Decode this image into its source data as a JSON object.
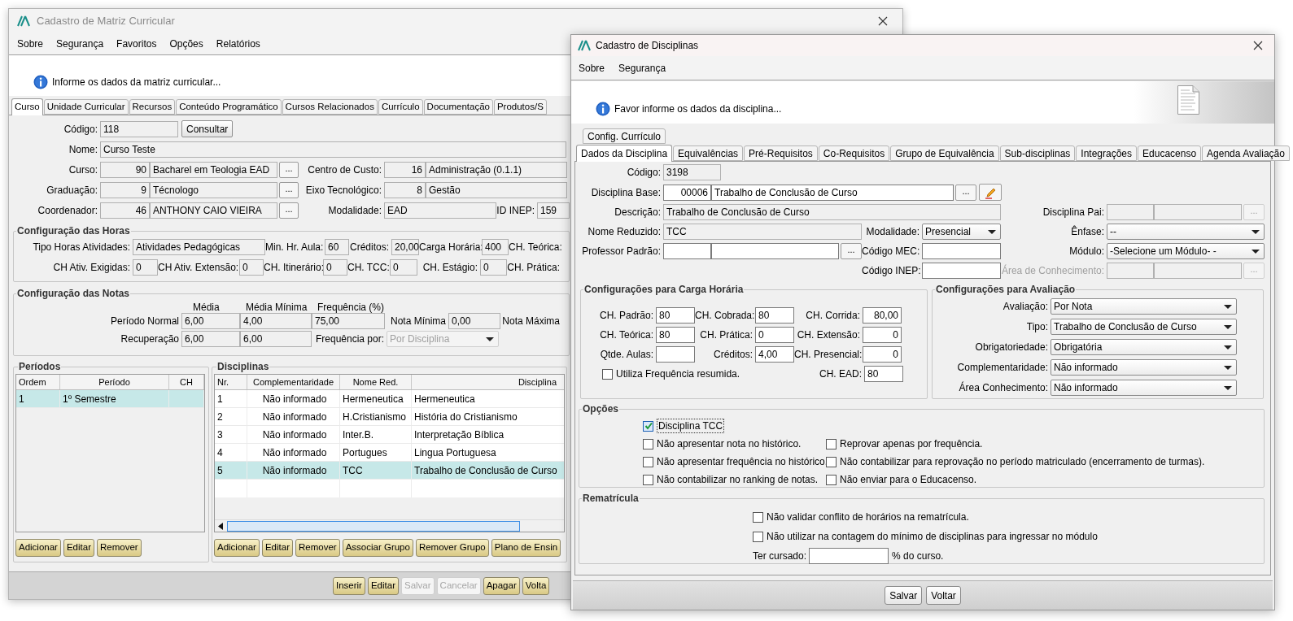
{
  "left": {
    "title": "Cadastro de Matriz Curricular",
    "menu": [
      "Sobre",
      "Segurança",
      "Favoritos",
      "Opções",
      "Relatórios"
    ],
    "info": "Informe os dados da matriz curricular...",
    "tabs": [
      {
        "label": "Curso",
        "selected": true
      },
      {
        "label": "Unidade Curricular",
        "selected": false
      },
      {
        "label": "Recursos",
        "selected": false
      },
      {
        "label": "Conteúdo Programático",
        "selected": false
      },
      {
        "label": "Cursos Relacionados",
        "selected": false
      },
      {
        "label": "Currículo",
        "selected": false
      },
      {
        "label": "Documentação",
        "selected": false
      },
      {
        "label": "Produtos/S",
        "selected": false
      }
    ],
    "codigo": {
      "label": "Código:",
      "value": "118",
      "button": "Consultar"
    },
    "nome": {
      "label": "Nome:",
      "value": "Curso Teste"
    },
    "curso": {
      "label": "Curso:",
      "code": "90",
      "value": "Bacharel em Teologia EAD",
      "button": "..."
    },
    "centro_custo": {
      "label": "Centro de Custo:",
      "code": "16",
      "value": "Administração (0.1.1)"
    },
    "graduacao": {
      "label": "Graduação:",
      "code": "9",
      "value": "Técnologo",
      "button": "..."
    },
    "eixo": {
      "label": "Eixo Tecnológico:",
      "code": "8",
      "value": "Gestão"
    },
    "coordenador": {
      "label": "Coordenador:",
      "code": "46",
      "value": "ANTHONY CAIO VIEIRA",
      "button": "..."
    },
    "modalidade": {
      "label": "Modalidade:",
      "value": "EAD"
    },
    "id_inep": {
      "label": "ID INEP:",
      "value": "159"
    },
    "horas": {
      "title": "Configuração das Horas",
      "fields": [
        {
          "label": "Tipo Horas Atividades:",
          "value": "Atividades Pedagógicas"
        },
        {
          "label": "Min. Hr. Aula:",
          "value": "60"
        },
        {
          "label": "Créditos:",
          "value": "20,00"
        },
        {
          "label": "Carga Horária:",
          "value": "400"
        },
        {
          "label": "CH. Teórica:"
        },
        {
          "label": "CH Ativ. Exigidas:",
          "value": "0"
        },
        {
          "label": "CH Ativ. Extensão:",
          "value": "0"
        },
        {
          "label": "CH. Itinerário:",
          "value": "0"
        },
        {
          "label": "CH. TCC:",
          "value": "0"
        },
        {
          "label": "CH. Estágio:",
          "value": "0"
        },
        {
          "label": "CH. Prática:"
        }
      ]
    },
    "notas": {
      "title": "Configuração das Notas",
      "headers": [
        "Média",
        "Média Mínima",
        "Frequência (%)"
      ],
      "rows": [
        {
          "label": "Período Normal",
          "values": [
            "6,00",
            "4,00",
            "75,00"
          ]
        },
        {
          "label": "Recuperação",
          "values": [
            "6,00",
            "6,00"
          ]
        }
      ],
      "nota_minima": {
        "label": "Nota Mínima",
        "value": "0,00"
      },
      "nota_maxima": {
        "label": "Nota Máxima"
      },
      "frequencia_por": {
        "label": "Frequência por:",
        "value": "Por Disciplina",
        "disabled": true
      }
    },
    "periodos": {
      "title": "Períodos",
      "columns": [
        "Ordem",
        "Período",
        "CH"
      ],
      "rows": [
        {
          "cells": [
            "1",
            "1º Semestre"
          ],
          "selected": true
        }
      ],
      "buttons": [
        "Adicionar",
        "Editar",
        "Remover"
      ]
    },
    "disciplinas": {
      "title": "Disciplinas",
      "columns": [
        "Nr.",
        "Complementaridade",
        "Nome Red.",
        "Disciplina"
      ],
      "rows": [
        {
          "cells": [
            "1",
            "Não informado",
            "Hermeneutica",
            "Hermeneutica"
          ],
          "selected": false
        },
        {
          "cells": [
            "2",
            "Não informado",
            "H.Cristianismo",
            "História do Cristianismo"
          ],
          "selected": false
        },
        {
          "cells": [
            "3",
            "Não informado",
            "Inter.B.",
            "Interpretação Bíblica"
          ],
          "selected": false
        },
        {
          "cells": [
            "4",
            "Não informado",
            "Portugues",
            "Lingua Portuguesa"
          ],
          "selected": false
        },
        {
          "cells": [
            "5",
            "Não informado",
            "TCC",
            "Trabalho de Conclusão de Curso"
          ],
          "selected": true
        }
      ],
      "buttons": [
        "Adicionar",
        "Editar",
        "Remover",
        "Associar Grupo",
        "Remover Grupo",
        "Plano de Ensin"
      ]
    },
    "footer_buttons": [
      {
        "label": "Inserir",
        "disabled": false
      },
      {
        "label": "Editar",
        "disabled": false
      },
      {
        "label": "Salvar",
        "disabled": true
      },
      {
        "label": "Cancelar",
        "disabled": true
      },
      {
        "label": "Apagar",
        "disabled": false
      },
      {
        "label": "Volta",
        "disabled": false
      }
    ]
  },
  "right": {
    "title": "Cadastro de Disciplinas",
    "menu": [
      "Sobre",
      "Segurança"
    ],
    "info": "Favor informe os dados da disciplina...",
    "tabs_back": [
      {
        "label": "Config. Currículo",
        "selected": false
      }
    ],
    "tabs": [
      {
        "label": "Dados da Disciplina",
        "selected": true
      },
      {
        "label": "Equivalências",
        "selected": false
      },
      {
        "label": "Pré-Requisitos",
        "selected": false
      },
      {
        "label": "Co-Requisitos",
        "selected": false
      },
      {
        "label": "Grupo de Equivalência",
        "selected": false
      },
      {
        "label": "Sub-disciplinas",
        "selected": false
      },
      {
        "label": "Integrações",
        "selected": false
      },
      {
        "label": "Educacenso",
        "selected": false
      },
      {
        "label": "Agenda Avaliação",
        "selected": false
      }
    ],
    "codigo": {
      "label": "Código:",
      "value": "3198",
      "disabled": true
    },
    "disciplina_base": {
      "label": "Disciplina Base:",
      "code": "00006",
      "value": "Trabalho de Conclusão de Curso",
      "button": "...",
      "disabled": false
    },
    "descricao": {
      "label": "Descrição:",
      "value": "Trabalho de Conclusão de Curso",
      "disabled": true
    },
    "disciplina_pai": {
      "label": "Disciplina Pai:",
      "button": "...",
      "disabled": true
    },
    "nome_reduzido": {
      "label": "Nome Reduzido:",
      "value": "TCC",
      "disabled": true
    },
    "modalidade": {
      "label": "Modalidade:",
      "value": "Presencial"
    },
    "enfase": {
      "label": "Ênfase:",
      "value": "--"
    },
    "professor": {
      "label": "Professor Padrão:",
      "button": "...",
      "disabled": false
    },
    "codigo_mec": {
      "label": "Código MEC:",
      "disabled": false
    },
    "modulo": {
      "label": "Módulo:",
      "value": "-Selecione um Módulo- -"
    },
    "codigo_inep": {
      "label": "Código INEP:",
      "disabled": false
    },
    "area": {
      "label": "Área de Conhecimento:",
      "button": "...",
      "disabled": true,
      "label_disabled": true
    },
    "carga": {
      "title": "Configurações para Carga Horária",
      "fields": [
        {
          "label": "CH. Padrão:",
          "value": "80"
        },
        {
          "label": "CH. Cobrada:",
          "value": "80"
        },
        {
          "label": "CH. Corrida:",
          "value": "80,00"
        },
        {
          "label": "CH. Teórica:",
          "value": "80"
        },
        {
          "label": "CH. Prática:",
          "value": "0"
        },
        {
          "label": "CH. Extensão:",
          "value": "0"
        },
        {
          "label": "Qtde. Aulas:"
        },
        {
          "label": "Créditos:",
          "value": "4,00"
        },
        {
          "label": "CH. Presencial:",
          "value": "0"
        },
        {
          "label": "CH. EAD:",
          "value": "80"
        }
      ],
      "frequencia_resumida": {
        "label": "Utiliza Frequência resumida.",
        "checked": false
      }
    },
    "avaliacao": {
      "title": "Configurações para Avaliação",
      "fields": [
        {
          "label": "Avaliação:",
          "value": "Por Nota"
        },
        {
          "label": "Tipo:",
          "value": "Trabalho de Conclusão de Curso"
        },
        {
          "label": "Obrigatoriedade:",
          "value": "Obrigatória"
        },
        {
          "label": "Complementaridade:",
          "value": "Não informado"
        },
        {
          "label": "Área Conhecimento:",
          "value": "Não informado"
        }
      ]
    },
    "opcoes": {
      "title": "Opções",
      "items": [
        {
          "label": "Disciplina TCC",
          "checked": true
        },
        {
          "label": "Não apresentar nota no histórico.",
          "checked": false
        },
        {
          "label": "Reprovar apenas por frequência.",
          "checked": false
        },
        {
          "label": "Não apresentar frequência no histórico.",
          "checked": false
        },
        {
          "label": "Não contabilizar para reprovação no período matriculado (encerramento de turmas).",
          "checked": false
        },
        {
          "label": "Não contabilizar no ranking de notas.",
          "checked": false
        },
        {
          "label": "Não enviar para o Educacenso.",
          "checked": false
        }
      ]
    },
    "rematricula": {
      "title": "Rematrícula",
      "items": [
        {
          "label": "Não validar conflito de horários na rematrícula.",
          "checked": false
        },
        {
          "label": "Não utilizar na contagem do mínimo de disciplinas para ingressar no módulo",
          "checked": false
        }
      ],
      "ter_cursado": {
        "label": "Ter cursado:",
        "suffix": "% do curso."
      }
    },
    "buttons": [
      "Salvar",
      "Voltar"
    ]
  }
}
